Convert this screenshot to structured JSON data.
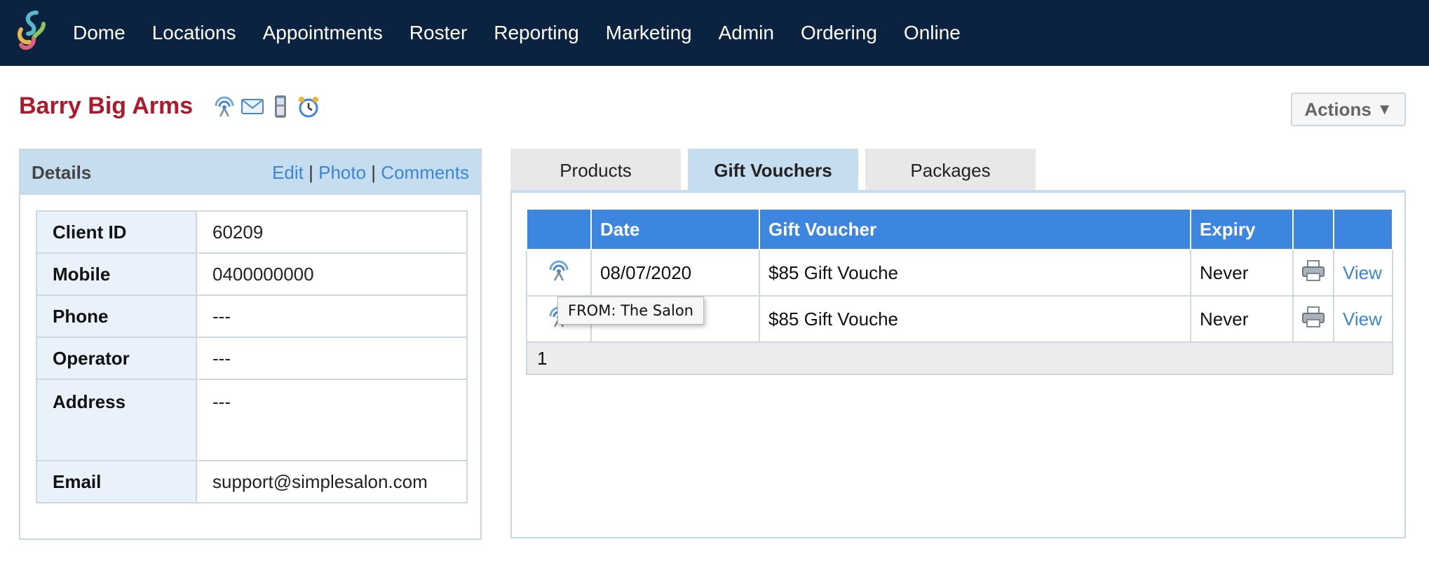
{
  "nav": {
    "logo_icon": "simple-salon-logo-icon",
    "items": [
      "Dome",
      "Locations",
      "Appointments",
      "Roster",
      "Reporting",
      "Marketing",
      "Admin",
      "Ordering",
      "Online"
    ]
  },
  "client": {
    "name": "Barry Big Arms",
    "icons": [
      "broadcast-icon",
      "email-icon",
      "mobile-phone-icon",
      "alarm-clock-icon"
    ]
  },
  "actions": {
    "label": "Actions",
    "caret": "▼"
  },
  "details": {
    "title": "Details",
    "links": {
      "edit": "Edit",
      "photo": "Photo",
      "comments": "Comments",
      "separator": "|"
    },
    "rows": [
      {
        "label": "Client ID",
        "value": "60209"
      },
      {
        "label": "Mobile",
        "value": "0400000000"
      },
      {
        "label": "Phone",
        "value": "---"
      },
      {
        "label": "Operator",
        "value": "---"
      },
      {
        "label": "Address",
        "value": "---"
      },
      {
        "label": "Email",
        "value": "support@simplesalon.com"
      }
    ]
  },
  "tabs": [
    {
      "label": "Products",
      "active": false
    },
    {
      "label": "Gift Vouchers",
      "active": true
    },
    {
      "label": "Packages",
      "active": false
    }
  ],
  "gift_vouchers": {
    "columns": [
      "",
      "Date",
      "Gift Voucher",
      "Expiry",
      "",
      ""
    ],
    "rows": [
      {
        "date": "08/07/2020",
        "voucher": "$85 Gift Vouche",
        "expiry": "Never",
        "action": "View"
      },
      {
        "date": "",
        "voucher": "$85 Gift Vouche",
        "expiry": "Never",
        "action": "View"
      }
    ],
    "pager": "1"
  },
  "tooltip": "FROM: The Salon",
  "colors": {
    "nav_bg": "#0b2340",
    "client_name": "#b0182b",
    "table_header": "#3d86e0",
    "panel_header": "#c6ddf0",
    "link": "#3a86d6"
  }
}
